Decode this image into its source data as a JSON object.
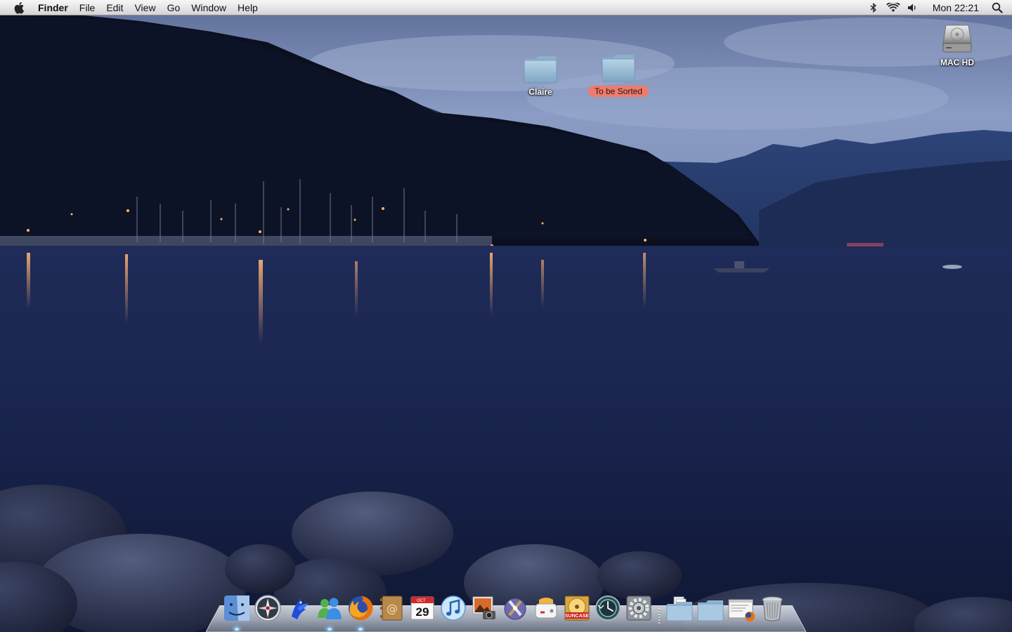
{
  "menubar": {
    "app_name": "Finder",
    "menus": [
      "File",
      "Edit",
      "View",
      "Go",
      "Window",
      "Help"
    ],
    "clock": "Mon 22:21",
    "status_icons": [
      "bluetooth-icon",
      "wifi-icon",
      "volume-icon",
      "spotlight-icon"
    ]
  },
  "desktop_icons": [
    {
      "label": "Claire",
      "icon": "folder-icon",
      "tag_color": ""
    },
    {
      "label": "To be Sorted",
      "icon": "folder-icon",
      "tag_color": "#f07a6c"
    },
    {
      "label": "MAC HD",
      "icon": "hard-drive-icon",
      "tag_color": ""
    }
  ],
  "calendar": {
    "month": "OCT",
    "day": "29"
  },
  "suncase_label": "SUNCASE",
  "dock": {
    "apps": [
      {
        "name": "finder",
        "icon": "finder-icon",
        "running": true
      },
      {
        "name": "safari",
        "icon": "compass-icon",
        "running": false
      },
      {
        "name": "colloquy",
        "icon": "blue-bird-icon",
        "running": false
      },
      {
        "name": "messenger",
        "icon": "messenger-people-icon",
        "running": true
      },
      {
        "name": "firefox",
        "icon": "firefox-icon",
        "running": true
      },
      {
        "name": "address-book",
        "icon": "address-book-icon",
        "running": false
      },
      {
        "name": "ical",
        "icon": "calendar-icon",
        "running": false
      },
      {
        "name": "itunes",
        "icon": "music-note-icon",
        "running": false
      },
      {
        "name": "iphoto",
        "icon": "photo-camera-icon",
        "running": false
      },
      {
        "name": "iwork",
        "icon": "tools-icon",
        "running": false
      },
      {
        "name": "toast",
        "icon": "toaster-icon",
        "running": false
      },
      {
        "name": "suncase",
        "icon": "disc-icon",
        "running": false
      },
      {
        "name": "time-machine",
        "icon": "time-machine-icon",
        "running": false
      },
      {
        "name": "system-preferences",
        "icon": "gear-icon",
        "running": false
      }
    ],
    "stacks": [
      {
        "name": "documents-stack",
        "icon": "documents-folder-icon"
      },
      {
        "name": "downloads-stack",
        "icon": "folder-icon"
      },
      {
        "name": "firefox-downloads",
        "icon": "window-firefox-icon"
      },
      {
        "name": "trash",
        "icon": "trash-icon"
      }
    ]
  }
}
